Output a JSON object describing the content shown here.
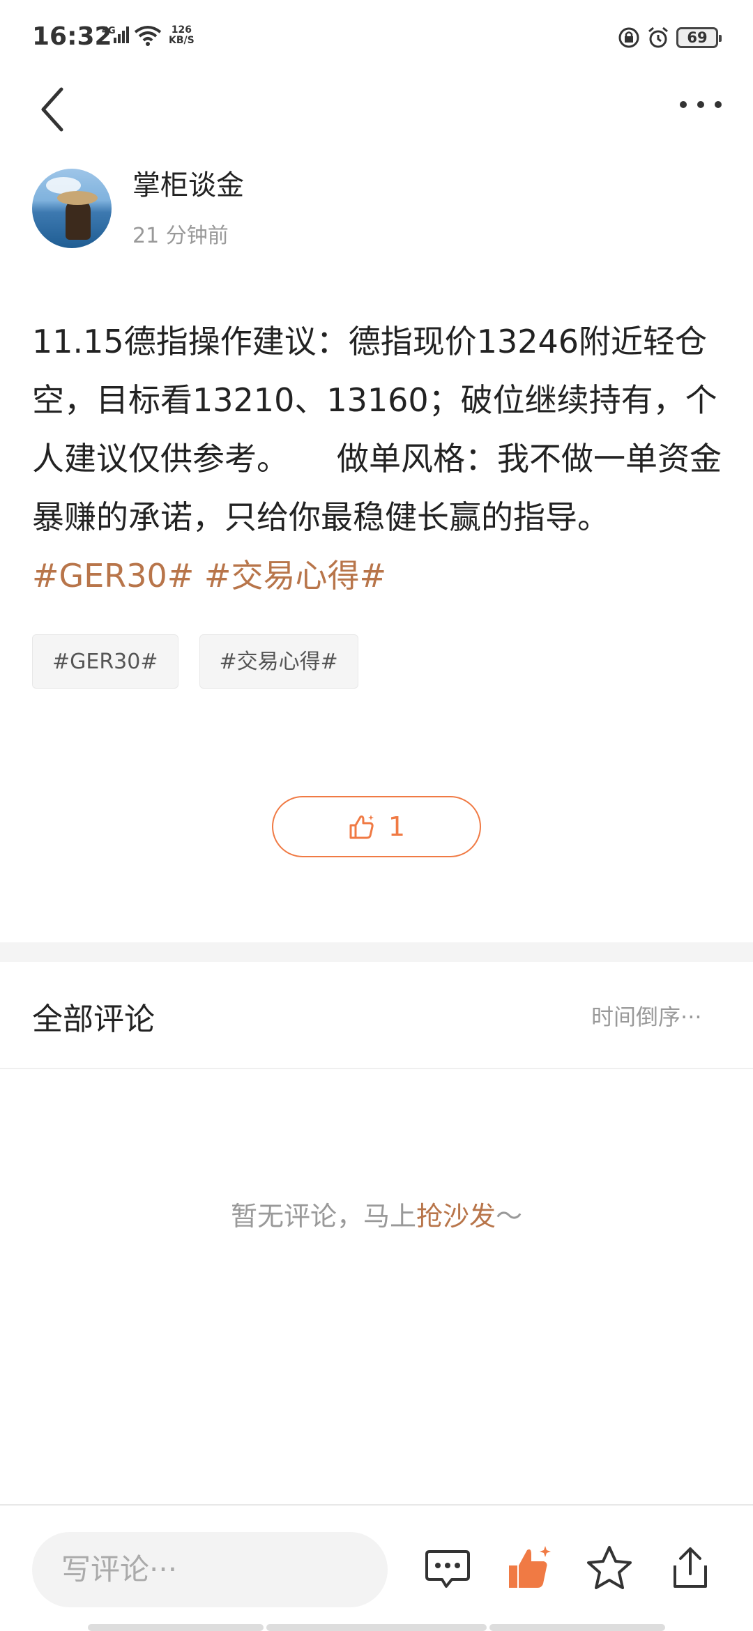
{
  "status_bar": {
    "time": "16:32",
    "network": "4G",
    "speed_value": "126",
    "speed_unit": "KB/S",
    "battery": "69"
  },
  "author": {
    "name": "掌柜谈金",
    "time": "21 分钟前"
  },
  "post": {
    "text": "11.15德指操作建议：德指现价13246附近轻仓空，目标看13210、13160；破位继续持有，个人建议仅供参考。　　做单风格：我不做一单资金暴赚的承诺，只给你最稳健长赢的指导。",
    "inline_tags": [
      "#GER30#",
      "#交易心得#"
    ],
    "chips": [
      "#GER30#",
      "#交易心得#"
    ]
  },
  "like": {
    "count": "1"
  },
  "comments": {
    "title": "全部评论",
    "sort_label": "时间倒序",
    "empty_prefix": "暂无评论，马上",
    "empty_cta": "抢沙发",
    "empty_suffix": "～"
  },
  "bottom_bar": {
    "input_placeholder": "写评论···"
  },
  "colors": {
    "accent": "#f07a44",
    "tag": "#b8754a",
    "muted": "#999999"
  },
  "icons": {
    "back": "chevron-left-icon",
    "more": "more-dots-icon",
    "like": "thumbs-up-icon",
    "comment": "comment-bubble-icon",
    "favorite": "star-icon",
    "share": "share-icon"
  }
}
